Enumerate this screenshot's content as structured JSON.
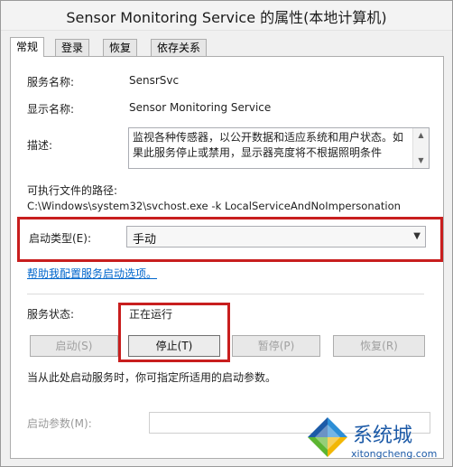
{
  "window": {
    "title": "Sensor Monitoring Service 的属性(本地计算机)"
  },
  "tabs": [
    {
      "label": "常规"
    },
    {
      "label": "登录"
    },
    {
      "label": "恢复"
    },
    {
      "label": "依存关系"
    }
  ],
  "general": {
    "service_name_label": "服务名称:",
    "service_name_value": "SensrSvc",
    "display_name_label": "显示名称:",
    "display_name_value": "Sensor Monitoring Service",
    "description_label": "描述:",
    "description_text": "监视各种传感器，以公开数据和适应系统和用户状态。如果此服务停止或禁用，显示器亮度将不根据照明条件",
    "exe_path_label": "可执行文件的路径:",
    "exe_path_value": "C:\\Windows\\system32\\svchost.exe -k LocalServiceAndNoImpersonation",
    "startup_type_label": "启动类型(E):",
    "startup_type_value": "手动",
    "help_link": "帮助我配置服务启动选项。",
    "service_status_label": "服务状态:",
    "service_status_value": "正在运行",
    "buttons": {
      "start": "启动(S)",
      "stop": "停止(T)",
      "pause": "暂停(P)",
      "resume": "恢复(R)"
    },
    "hint_text": "当从此处启动服务时，你可指定所适用的启动参数。",
    "start_params_label": "启动参数(M):",
    "start_params_value": ""
  },
  "watermark": {
    "brand": "系统城",
    "url": "xitongcheng.com",
    "colors": {
      "blue": "#1c5aa7",
      "green": "#5cb531",
      "yellow": "#f2b705",
      "lightblue": "#2c8ed6"
    }
  },
  "accent": {
    "highlight_red": "#c81e1e",
    "link_blue": "#0066cc"
  }
}
